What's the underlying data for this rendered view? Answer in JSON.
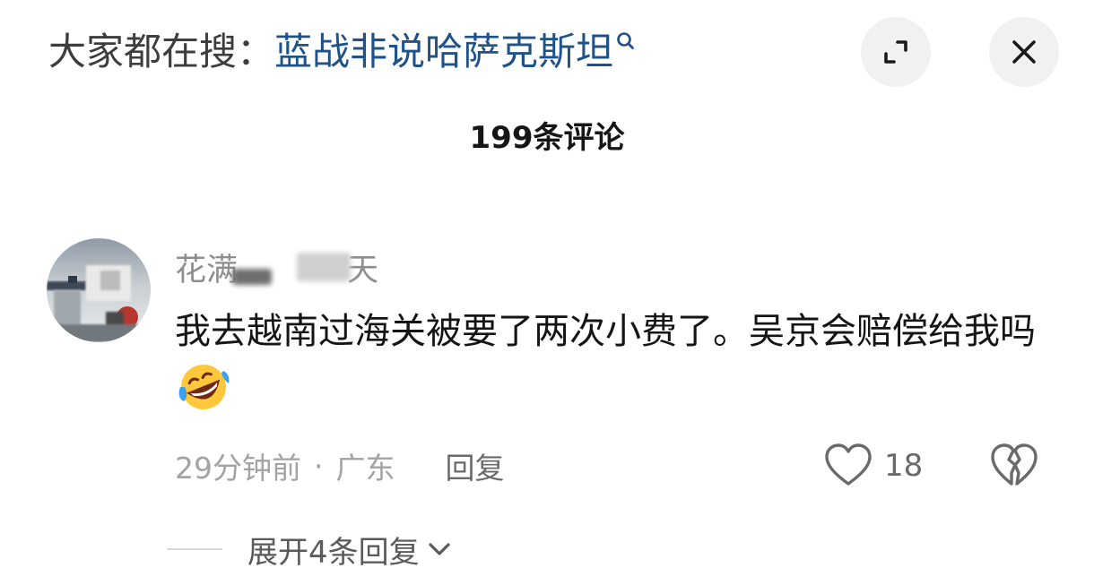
{
  "header": {
    "search_prefix": "大家都在搜：",
    "search_term": "蓝战非说哈萨克斯坦"
  },
  "comments_panel": {
    "count_label": "199条评论"
  },
  "comment": {
    "username_visible_start": "花满",
    "username_visible_end": "天",
    "text": "我去越南过海关被要了两次小费了。吴京会赔偿给我吗",
    "emoji": "rolling-on-floor-laughing",
    "time": "29分钟前",
    "separator": "·",
    "location": "广东",
    "reply_label": "回复",
    "like_count": "18",
    "expand_replies_label": "展开4条回复"
  },
  "colors": {
    "search_term": "#1f5288",
    "button_bg": "#f1f1f1",
    "meta_text": "#a3a3a3"
  }
}
